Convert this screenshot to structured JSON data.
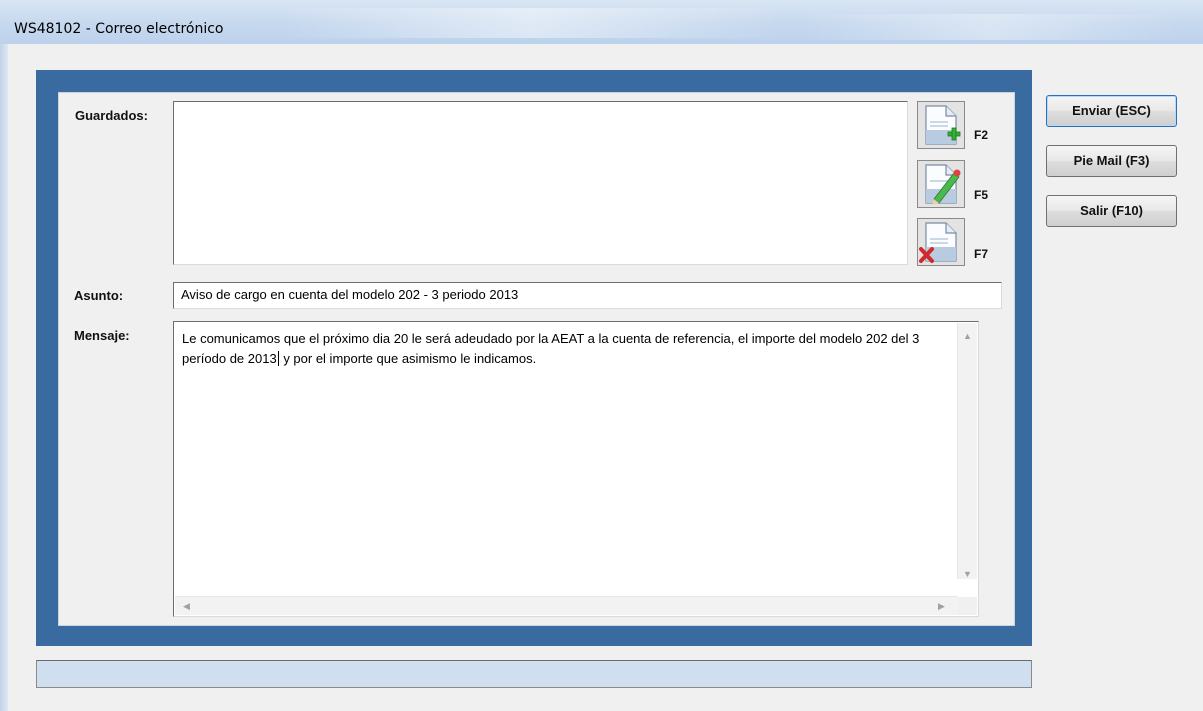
{
  "window": {
    "title": "WS48102 - Correo electrónico"
  },
  "form": {
    "saved_label": "Guardados:",
    "subject_label": "Asunto:",
    "message_label": "Mensaje:",
    "subject_value": "Aviso de cargo en cuenta del modelo 202 - 3 periodo 2013",
    "message_before_caret": "Le comunicamos que el próximo dia 20 le será adeudado por la AEAT a la cuenta de referencia, el importe del modelo 202 del 3 período de 2013",
    "message_after_caret": " y por el importe que asimismo le indicamos."
  },
  "saved_actions": [
    {
      "icon": "document-add-icon",
      "key": "F2"
    },
    {
      "icon": "document-edit-icon",
      "key": "F5"
    },
    {
      "icon": "document-delete-icon",
      "key": "F7"
    }
  ],
  "buttons": {
    "send": "Enviar (ESC)",
    "footer": "Pie Mail (F3)",
    "exit": "Salir (F10)"
  },
  "colors": {
    "frame": "#396aa0",
    "status_bar": "#cfdff0",
    "default_button_border": "#2a6fbd"
  }
}
